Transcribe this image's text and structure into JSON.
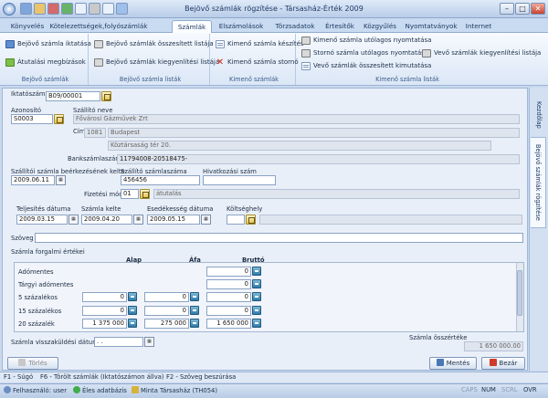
{
  "window": {
    "title": "Bejövő számlák rögzítése - Társasház-Érték 2009",
    "minimize": "–",
    "maximize": "□",
    "close": "✕"
  },
  "tabs": [
    "Könyvelés",
    "Kötelezettségek,folyószámlák",
    "Számlák",
    "Elszámolások",
    "Törzsadatok",
    "Értesítők",
    "Közgyűlés",
    "Nyomtatványok",
    "Internet"
  ],
  "ribbon": {
    "groups": [
      {
        "label": "Bejövő számlák",
        "items": [
          "Bejövő számla iktatása",
          "Átutalási megbízások"
        ]
      },
      {
        "label": "Bejövő számla listák",
        "items": [
          "Bejövő számlák összesített listája",
          "Bejövő számlák kiegyenlítési listája"
        ]
      },
      {
        "label": "Kimenő számlák",
        "items": [
          "Kimenő számla készítés",
          "Kimenő számla stornó"
        ]
      },
      {
        "label": "Kimenő számla listák",
        "items": [
          "Kimenő számla utólagos nyomtatása",
          "Stornó számla utólagos nyomtatása",
          "Vevő számlák összesített kimutatása",
          "Vevő számlák kiegyenlítési listája"
        ]
      }
    ]
  },
  "side_tabs": [
    "Kezdőlap",
    "Bejövő számlák rögzítése"
  ],
  "form": {
    "iktatoszam": {
      "label": "Iktatószám",
      "value": "B09/00001"
    },
    "azonosito": {
      "label": "Azonosító",
      "value": "S0003"
    },
    "szallito_neve": {
      "label": "Szállító neve",
      "value": "Fővárosi Gázművek Zrt"
    },
    "cim": {
      "label": "Cím",
      "zip": "1081",
      "city": "Budapest",
      "street": "Köztársaság tér 20."
    },
    "bankszamlaszam": {
      "label": "Bankszámlaszám",
      "value": "11794008-20518475-"
    },
    "beerkezes": {
      "label": "Szállítói számla beérkezésének kelte",
      "value": "2009.06.11"
    },
    "szamlaszam": {
      "label": "Szállító számlaszáma",
      "value": "456456"
    },
    "hivatkozasi": {
      "label": "Hivatkozási szám",
      "value": ""
    },
    "fizetesi_mod": {
      "label": "Fizetési mód",
      "code": "01",
      "name": "átutalás"
    },
    "teljesites": {
      "label": "Teljesítés dátuma",
      "value": "2009.03.15"
    },
    "kelte": {
      "label": "Számla kelte",
      "value": "2009.04.20"
    },
    "esedekesseg": {
      "label": "Esedékesség dátuma",
      "value": "2009.05.15"
    },
    "koltseghely": {
      "label": "Költséghely",
      "value": ""
    },
    "szoveg": {
      "label": "Szöveg",
      "value": ""
    },
    "table_title": "Számla forgalmi értékei",
    "columns": [
      "Alap",
      "Áfa",
      "Bruttó"
    ],
    "rows": [
      {
        "label": "Adómentes",
        "alap": "",
        "afa": "",
        "brutto": "0"
      },
      {
        "label": "Tárgyi adómentes",
        "alap": "",
        "afa": "",
        "brutto": "0"
      },
      {
        "label": "5 százalékos",
        "alap": "0",
        "afa": "0",
        "brutto": "0"
      },
      {
        "label": "15 százalékos",
        "alap": "0",
        "afa": "0",
        "brutto": "0"
      },
      {
        "label": "20 százalék",
        "alap": "1 375 000",
        "afa": "275 000",
        "brutto": "1 650 000"
      }
    ],
    "visszakuldes": {
      "label": "Számla visszaküldési dátuma",
      "value": ". ."
    },
    "osszertek": {
      "label": "Számla összértéke",
      "value": "1 650 000.00"
    }
  },
  "buttons": {
    "torles": "Törlés",
    "mentes": "Mentés",
    "bezar": "Bezár"
  },
  "hotkeys": [
    "F1 - Súgó",
    "F6 - Törölt számlák (Iktatószámon állva)",
    "F2 - Szöveg beszúrása"
  ],
  "status": {
    "user": "Felhasználó: user",
    "db": "Éles adatbázis",
    "house": "Minta Társasház (TH054)",
    "caps": "CAPS",
    "num": "NUM",
    "scrl": "SCRL",
    "ovr": "OVR"
  },
  "colors": {
    "accent": "#2f5fa3",
    "ribbon_bg": "#dbe7f6",
    "form_bg": "#e9eff8",
    "readonly": "#dfe5ee"
  }
}
